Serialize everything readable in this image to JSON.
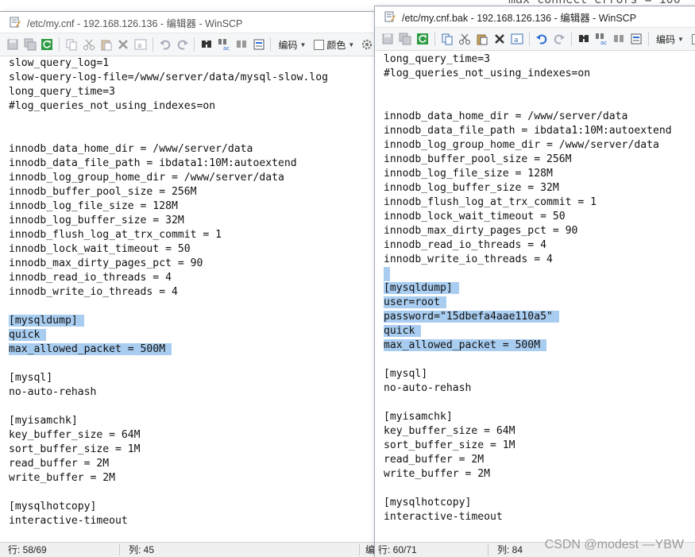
{
  "background": {
    "partial_text": "max_connect_errors = 100"
  },
  "window_left": {
    "title": "/etc/my.cnf - 192.168.126.136 - 编辑器 - WinSCP",
    "toolbar": {
      "encoding_label": "编码",
      "color_label": "颜色"
    },
    "lines": [
      "slow_query_log=1",
      "slow-query-log-file=/www/server/data/mysql-slow.log",
      "long_query_time=3",
      "#log_queries_not_using_indexes=on",
      "",
      "",
      "innodb_data_home_dir = /www/server/data",
      "innodb_data_file_path = ibdata1:10M:autoextend",
      "innodb_log_group_home_dir = /www/server/data",
      "innodb_buffer_pool_size = 256M",
      "innodb_log_file_size = 128M",
      "innodb_log_buffer_size = 32M",
      "innodb_flush_log_at_trx_commit = 1",
      "innodb_lock_wait_timeout = 50",
      "innodb_max_dirty_pages_pct = 90",
      "innodb_read_io_threads = 4",
      "innodb_write_io_threads = 4",
      "",
      "[mysqldump]",
      "quick",
      "max_allowed_packet = 500M",
      "",
      "[mysql]",
      "no-auto-rehash",
      "",
      "[myisamchk]",
      "key_buffer_size = 64M",
      "sort_buffer_size = 1M",
      "read_buffer = 2M",
      "write_buffer = 2M",
      "",
      "[mysqlhotcopy]",
      "interactive-timeout"
    ],
    "selected_lines": [
      18,
      19,
      20
    ],
    "status": {
      "line": "行: 58/69",
      "col": "列: 45",
      "encoding": "编"
    }
  },
  "window_right": {
    "title": "/etc/my.cnf.bak - 192.168.126.136 - 编辑器 - WinSCP",
    "toolbar": {
      "encoding_label": "编码"
    },
    "lines": [
      "long_query_time=3",
      "#log_queries_not_using_indexes=on",
      "",
      "",
      "innodb_data_home_dir = /www/server/data",
      "innodb_data_file_path = ibdata1:10M:autoextend",
      "innodb_log_group_home_dir = /www/server/data",
      "innodb_buffer_pool_size = 256M",
      "innodb_log_file_size = 128M",
      "innodb_log_buffer_size = 32M",
      "innodb_flush_log_at_trx_commit = 1",
      "innodb_lock_wait_timeout = 50",
      "innodb_max_dirty_pages_pct = 90",
      "innodb_read_io_threads = 4",
      "innodb_write_io_threads = 4",
      "",
      "[mysqldump]",
      "user=root",
      "password=\"15dbefa4aae110a5\"",
      "quick",
      "max_allowed_packet = 500M",
      "",
      "[mysql]",
      "no-auto-rehash",
      "",
      "[myisamchk]",
      "key_buffer_size = 64M",
      "sort_buffer_size = 1M",
      "read_buffer = 2M",
      "write_buffer = 2M",
      "",
      "[mysqlhotcopy]",
      "interactive-timeout"
    ],
    "selected_lines": [
      15,
      16,
      17,
      18,
      19,
      20
    ],
    "status": {
      "line": "行: 60/71",
      "col": "列: 84"
    }
  },
  "watermark": "CSDN @modest —YBW",
  "colors": {
    "selection": "#a9cdf0",
    "toolbar_bg": "#f5f6f7",
    "status_bg": "#f0f0f0"
  }
}
